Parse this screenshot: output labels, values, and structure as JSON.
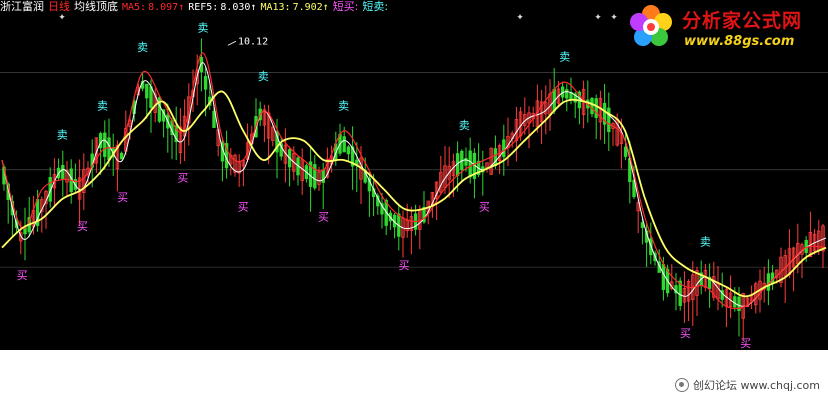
{
  "header": {
    "stock_name": "浙江富润",
    "period": "日线",
    "indicator_name": "均线顶底",
    "ma5_label": "MA5:",
    "ma5_value": "8.097↑",
    "ref5_label": "REF5:",
    "ref5_value": "8.030↑",
    "ma13_label": "MA13:",
    "ma13_value": "7.902↑",
    "short_buy": "短买:",
    "short_sell": "短卖:"
  },
  "price_label": "10.12",
  "signals": {
    "buy": "买",
    "sell": "卖"
  },
  "logo": {
    "title": "分析家公式网",
    "url": "www.88gs.com"
  },
  "footer": {
    "watermark": "创幻论坛 www.chqj.com"
  },
  "colors": {
    "background": "#000000",
    "up_candle": "#ff3c3c",
    "down_candle": "#30d830",
    "ma5": "#ffffff",
    "ref5": "#ff2a2a",
    "ma13": "#ffff66",
    "buy_label": "#ff55ff",
    "sell_label": "#55ffff",
    "grid": "#555555",
    "stock_name": "#ffffff",
    "period": "#ff2a2a",
    "ma5_text": "#ff2a2a",
    "ref5_text": "#ffffff",
    "ma13_text": "#ffff66",
    "short_buy_text": "#ff55ff",
    "short_sell_text": "#55ffff"
  },
  "chart_data": {
    "type": "line",
    "x": [
      0,
      20,
      40,
      60,
      80,
      100,
      120,
      140,
      160,
      180,
      200,
      220,
      240,
      260,
      280,
      300,
      320,
      340,
      360,
      380,
      400,
      420,
      440,
      460,
      480,
      500,
      520,
      540,
      560,
      580,
      600,
      620,
      640,
      660,
      680,
      700,
      720,
      740,
      760,
      780,
      800,
      820
    ],
    "series": [
      {
        "name": "MA5",
        "values": [
          8.9,
          8.1,
          8.4,
          8.8,
          8.6,
          9.1,
          8.9,
          9.7,
          9.4,
          9.1,
          9.9,
          9.0,
          8.8,
          9.4,
          9.0,
          8.8,
          8.7,
          9.1,
          8.8,
          8.4,
          8.2,
          8.3,
          8.7,
          8.9,
          8.8,
          9.0,
          9.3,
          9.4,
          9.6,
          9.5,
          9.4,
          9.1,
          8.2,
          7.7,
          7.5,
          7.7,
          7.5,
          7.4,
          7.6,
          7.8,
          8.0,
          8.1
        ]
      },
      {
        "name": "REF5",
        "values": [
          8.9,
          8.2,
          8.6,
          8.7,
          8.7,
          9.0,
          9.1,
          9.8,
          9.5,
          9.2,
          10.0,
          9.1,
          8.9,
          9.4,
          9.1,
          8.9,
          8.8,
          9.2,
          8.9,
          8.5,
          8.3,
          8.3,
          8.6,
          8.8,
          8.9,
          9.0,
          9.2,
          9.5,
          9.7,
          9.5,
          9.3,
          9.1,
          8.3,
          7.8,
          7.6,
          7.6,
          7.4,
          7.4,
          7.6,
          7.8,
          8.0,
          8.0
        ]
      },
      {
        "name": "MA13",
        "values": [
          8.0,
          8.2,
          8.3,
          8.5,
          8.6,
          8.8,
          9.1,
          9.3,
          9.5,
          9.2,
          9.4,
          9.6,
          9.2,
          8.9,
          9.1,
          9.1,
          8.9,
          8.9,
          8.8,
          8.6,
          8.4,
          8.4,
          8.5,
          8.7,
          8.8,
          8.9,
          9.1,
          9.3,
          9.5,
          9.5,
          9.4,
          9.2,
          8.5,
          8.0,
          7.8,
          7.7,
          7.6,
          7.5,
          7.6,
          7.7,
          7.9,
          8.0
        ]
      }
    ],
    "annotations": [
      {
        "text": "10.12",
        "x": 230,
        "y": 10.12
      }
    ]
  }
}
